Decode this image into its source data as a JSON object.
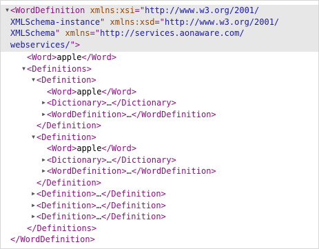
{
  "root": {
    "open_parts": [
      "<WordDefinition ",
      "xmlns:xsi",
      "=\"",
      "http://www.w3.org/2001/",
      "XMLSchema-instance",
      "\" ",
      "xmlns:xsd",
      "=\"",
      "http://www.w3.org/2001/",
      "XMLSchema",
      "\" ",
      "xmlns",
      "=\"",
      "http://services.aonaware.com/",
      "webservices/",
      "\">"
    ],
    "word_open": "<Word>",
    "word_text": "apple",
    "word_close": "</Word>",
    "definitions_open": "<Definitions>",
    "definitions_close": "</Definitions>",
    "close": "</WordDefinition>"
  },
  "definition": {
    "open": "<Definition>",
    "close": "</Definition>",
    "word_open": "<Word>",
    "word_text": "apple",
    "word_close": "</Word>",
    "dictionary_open": "<Dictionary>",
    "dictionary_close": "</Dictionary>",
    "worddef_open": "<WordDefinition>",
    "worddef_close": "</WordDefinition>",
    "ellipsis": "…"
  },
  "collapsed_definitions": [
    {
      "open": "<Definition>",
      "ellipsis": "…",
      "close": "</Definition>"
    },
    {
      "open": "<Definition>",
      "ellipsis": "…",
      "close": "</Definition>"
    },
    {
      "open": "<Definition>",
      "ellipsis": "…",
      "close": "</Definition>"
    }
  ],
  "icons": {
    "expanded": "▼",
    "collapsed": "▶"
  }
}
